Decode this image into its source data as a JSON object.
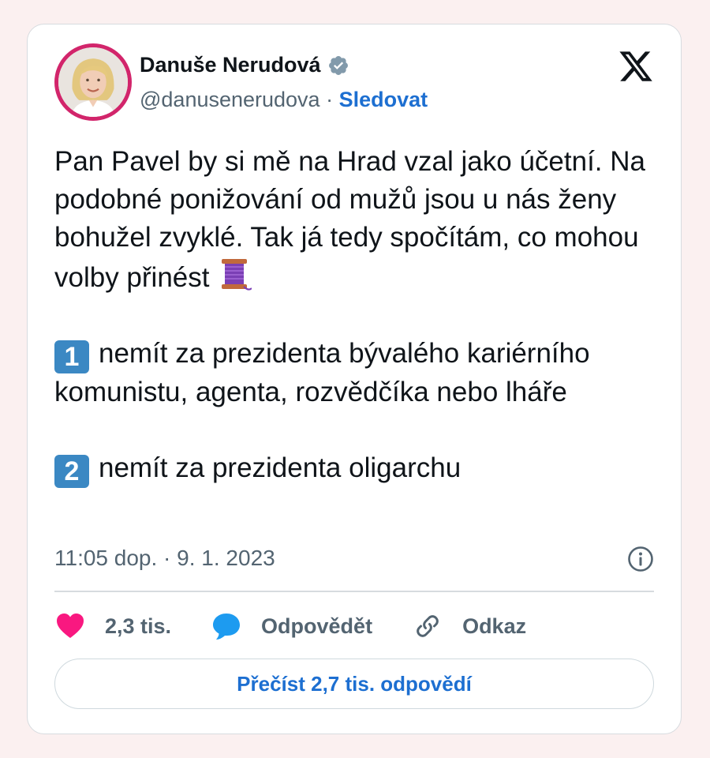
{
  "author": {
    "name": "Danuše Nerudová",
    "handle": "@danusenerudova",
    "separator": "·",
    "follow_label": "Sledovat",
    "verified_icon": "verified-badge-icon",
    "verified_color": "#829aab"
  },
  "brand": {
    "logo": "x-logo-icon"
  },
  "tweet": {
    "paragraph1": "Pan Pavel by si mě na Hrad vzal jako účetní. Na podobné ponižování od mužů jsou u nás ženy bohužel zvyklé. Tak já tedy spočítám, co mohou volby přinést",
    "paragraph1_emoji": "spool-of-thread-icon",
    "item1_number": "1",
    "item1_text": "nemít za prezidenta bývalého kariérního komunistu, agenta, rozvědčíka nebo lháře",
    "item2_number": "2",
    "item2_text": "nemít za prezidenta oligarchu"
  },
  "meta": {
    "time": "11:05 dop.",
    "separator": "·",
    "date": "9. 1. 2023"
  },
  "actions": {
    "like_count": "2,3 tis.",
    "reply_label": "Odpovědět",
    "link_label": "Odkaz"
  },
  "read_replies_label": "Přečíst 2,7 tis. odpovědí",
  "colors": {
    "accent": "#1d6fd1",
    "like": "#f91880",
    "reply_icon": "#1d9bf0",
    "avatar_ring": "#d2256b",
    "keycap": "#3b88c3"
  }
}
